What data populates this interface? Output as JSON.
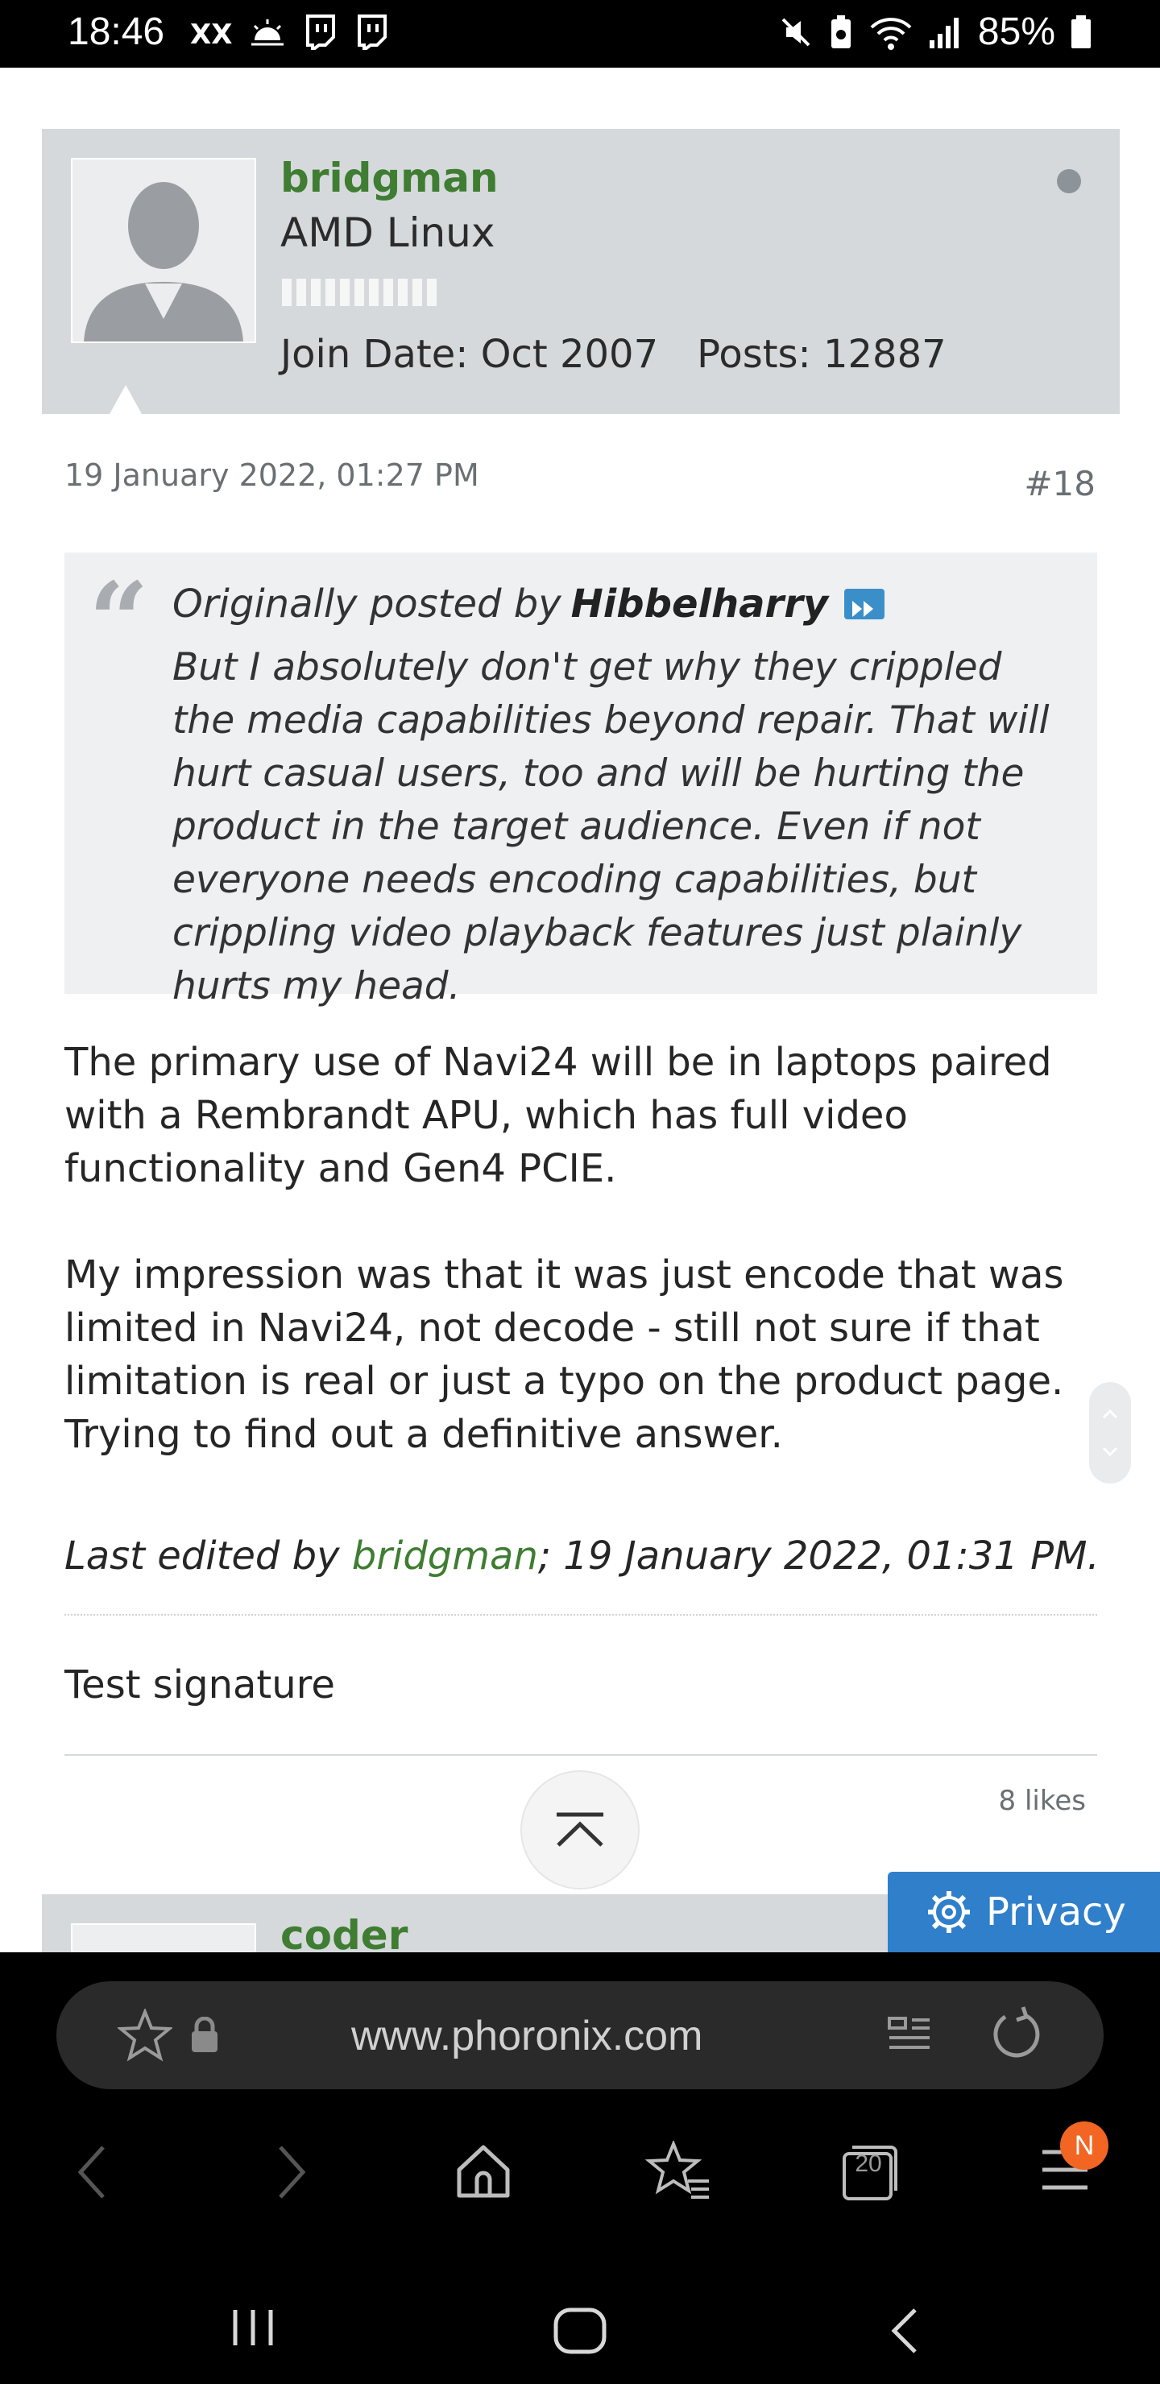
{
  "status_bar": {
    "time": "18:46",
    "battery": "85%"
  },
  "post": {
    "username": "bridgman",
    "user_title": "AMD Linux",
    "join_date": "Join Date: Oct 2007",
    "posts": "Posts: 12887",
    "date": "19 January 2022, 01:27 PM",
    "number": "#18",
    "quote": {
      "prefix": "Originally posted by",
      "author": "Hibbelharry",
      "text": "But I absolutely don't get why they crippled the media capabilities beyond repair. That will hurt casual users, too and will be hurting the product in the target audience. Even if not everyone needs encoding capabilities, but crippling video playback features just plainly hurts my head."
    },
    "paragraphs": [
      "The primary use of Navi24 will be in laptops paired with a Rembrandt APU, which has full video functionality and Gen4 PCIE.",
      "My impression was that it was just encode that was limited in Navi24, not decode - still not sure if that limitation is real or just a typo on the product page. Trying to find out a definitive answer."
    ],
    "edited_prefix": "Last edited by ",
    "edited_by": "bridgman",
    "edited_suffix": "; 19 January 2022, 01:31 PM.",
    "signature": "Test signature",
    "likes": "8 likes"
  },
  "next_post": {
    "username": "coder"
  },
  "privacy_button": "Privacy",
  "browser": {
    "url": "www.phoronix.com",
    "tab_count": "20",
    "menu_badge": "N"
  }
}
